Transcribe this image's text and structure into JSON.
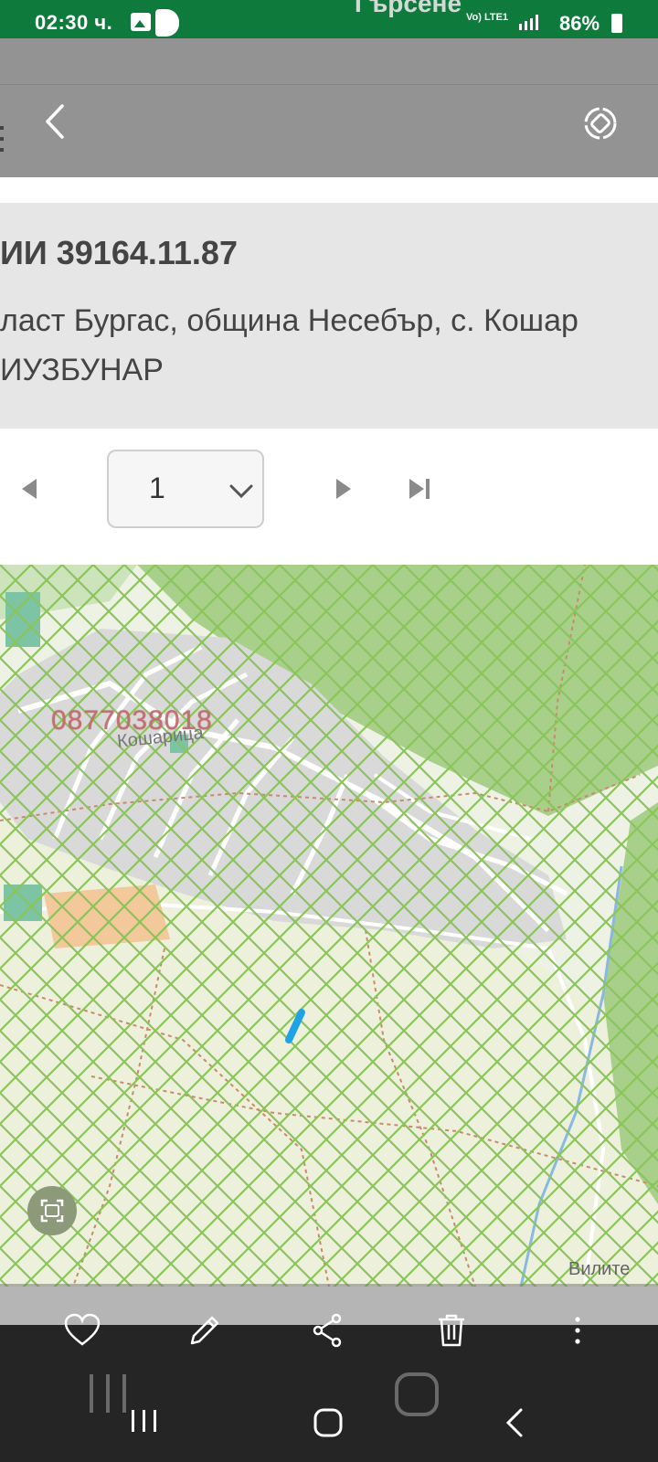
{
  "status_bar": {
    "time": "02:30 ч.",
    "app_title": "Гърсене",
    "network": "Vo) LTE1",
    "battery": "86%"
  },
  "document": {
    "title": "ИИ 39164.11.87",
    "address": "ласт Бургас, община Несебър, с. Кошар",
    "place": "ИУЗБУНАР"
  },
  "pager": {
    "current_page": "1"
  },
  "map": {
    "watermark_phone": "0877038018",
    "village_label": "Кошарица",
    "place_label": "Вилите"
  },
  "icons": {
    "back": "chevron-left-icon",
    "rotate": "rotate-screen-icon",
    "prev": "triangle-left-icon",
    "next": "triangle-right-icon",
    "last": "skip-last-icon",
    "lens": "image-search-icon",
    "favorite": "heart-icon",
    "edit": "pencil-icon",
    "share": "share-icon",
    "delete": "trash-icon",
    "more": "more-vertical-icon"
  },
  "colors": {
    "status_green": "#0e7a3c",
    "hatch_green": "#8ac45a",
    "parcel_blue": "#1fa3e6"
  }
}
